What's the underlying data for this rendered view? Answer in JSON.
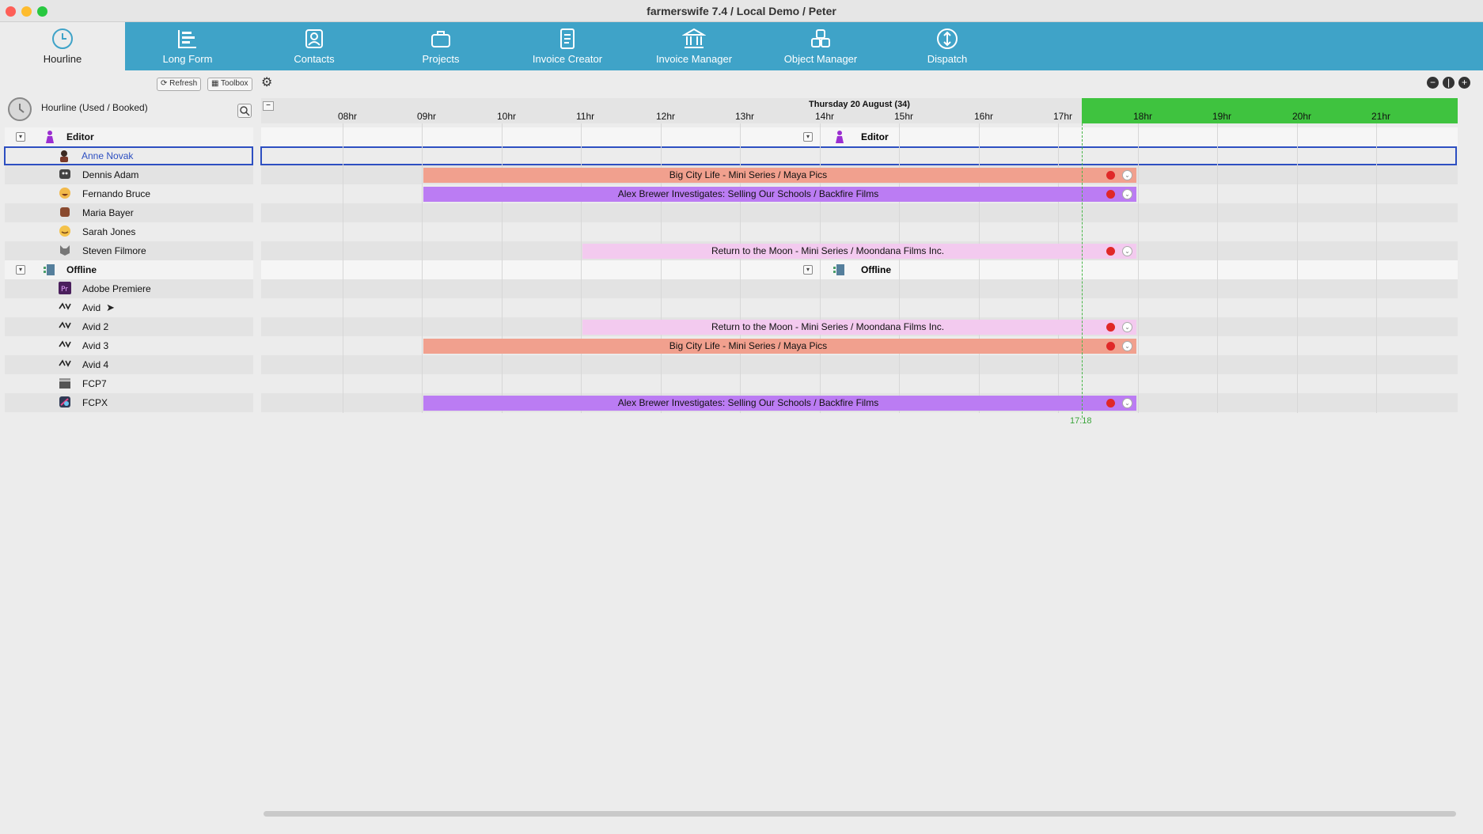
{
  "window": {
    "title": "farmerswife 7.4  / Local Demo / Peter"
  },
  "nav": {
    "items": [
      {
        "label": "Hourline",
        "icon": "clock-icon",
        "active": true
      },
      {
        "label": "Long Form",
        "icon": "longform-icon",
        "active": false
      },
      {
        "label": "Contacts",
        "icon": "contacts-icon",
        "active": false
      },
      {
        "label": "Projects",
        "icon": "briefcase-icon",
        "active": false
      },
      {
        "label": "Invoice Creator",
        "icon": "document-icon",
        "active": false
      },
      {
        "label": "Invoice Manager",
        "icon": "bank-icon",
        "active": false
      },
      {
        "label": "Object Manager",
        "icon": "cubes-icon",
        "active": false
      },
      {
        "label": "Dispatch",
        "icon": "dispatch-icon",
        "active": false
      }
    ]
  },
  "toolbar": {
    "refresh_label": "Refresh",
    "toolbox_label": "Toolbox",
    "settings_icon": "gear-icon"
  },
  "left_header": {
    "label": "Hourline (Used / Booked)"
  },
  "timeline": {
    "date_label": "Thursday 20 August (34)",
    "hours": [
      "08hr",
      "09hr",
      "10hr",
      "11hr",
      "12hr",
      "13hr",
      "14hr",
      "15hr",
      "16hr",
      "17hr",
      "18hr",
      "19hr",
      "20hr",
      "21hr"
    ],
    "now_label": "17:18",
    "colors": {
      "now_band": "#3fc33f",
      "header": "#e4e4e4",
      "nav": "#3fa3c8"
    }
  },
  "groups": {
    "editor": {
      "label": "Editor"
    },
    "offline": {
      "label": "Offline"
    }
  },
  "resources": {
    "anne": {
      "label": "Anne Novak"
    },
    "dennis": {
      "label": "Dennis Adam"
    },
    "fernando": {
      "label": "Fernando Bruce"
    },
    "maria": {
      "label": "Maria Bayer"
    },
    "sarah": {
      "label": "Sarah Jones"
    },
    "steven": {
      "label": "Steven Filmore"
    },
    "premiere": {
      "label": "Adobe Premiere"
    },
    "avid": {
      "label": "Avid"
    },
    "avid2": {
      "label": "Avid 2"
    },
    "avid3": {
      "label": "Avid 3"
    },
    "avid4": {
      "label": "Avid 4"
    },
    "fcp7": {
      "label": "FCP7"
    },
    "fcpx": {
      "label": "FCPX"
    }
  },
  "bookings": {
    "dennis": {
      "label": "Big City Life - Mini Series / Maya Pics",
      "color": "#f1a08e"
    },
    "fernando": {
      "label": "Alex Brewer Investigates: Selling Our Schools / Backfire Films",
      "color": "#bb7cf3"
    },
    "steven": {
      "label": "Return to the Moon - Mini Series / Moondana Films Inc.",
      "color": "#f3caef"
    },
    "avid2": {
      "label": "Return to the Moon - Mini Series / Moondana Films Inc.",
      "color": "#f3caef"
    },
    "avid3": {
      "label": "Big City Life - Mini Series / Maya Pics",
      "color": "#f1a08e"
    },
    "fcpx": {
      "label": "Alex Brewer Investigates: Selling Our Schools / Backfire Films",
      "color": "#bb7cf3"
    }
  }
}
